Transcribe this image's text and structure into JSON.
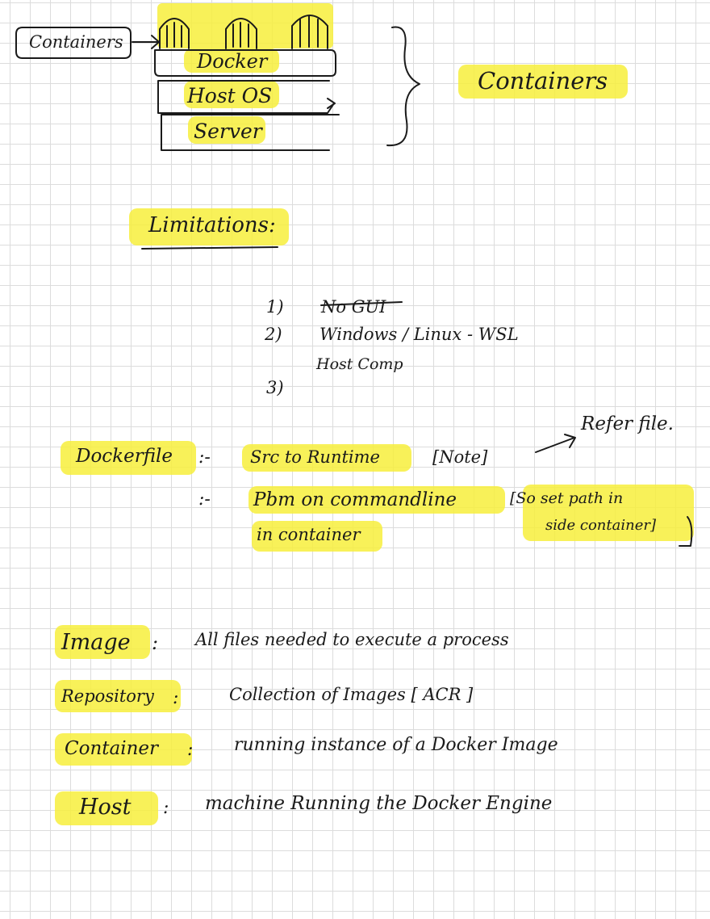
{
  "diagram": {
    "callout_label": "Containers",
    "layers": [
      "Docker",
      "Host OS",
      "Server"
    ],
    "brace_label": "Containers"
  },
  "limitations": {
    "heading": "Limitations:",
    "items": [
      {
        "num": "1)",
        "text": "No GUI"
      },
      {
        "num": "2)",
        "text": "Windows / Linux  - WSL",
        "subtext": "Host Comp"
      },
      {
        "num": "3)",
        "text": ""
      }
    ]
  },
  "dockerfile": {
    "label": "Dockerfile",
    "points": [
      {
        "sep": ":-",
        "text": "Src to Runtime",
        "note": "[Note]",
        "arrow_note": "Refer file."
      },
      {
        "sep": ":-",
        "text": "Pbm on commandline",
        "text2": "in container",
        "note": "[So set path in",
        "note2": "side container]"
      }
    ]
  },
  "definitions": [
    {
      "term": "Image",
      "sep": ":",
      "definition": "All files needed to execute a process"
    },
    {
      "term": "Repository",
      "sep": ":",
      "definition": "Collection of Images   [ ACR ]"
    },
    {
      "term": "Container",
      "sep": ":",
      "definition": "running instance of a Docker Image"
    },
    {
      "term": "Host",
      "sep": ":",
      "definition": "machine Running the Docker Engine"
    }
  ],
  "colors": {
    "highlight": "#f7ef3c",
    "ink": "#1a1a1a",
    "grid": "#dcdcdc"
  }
}
